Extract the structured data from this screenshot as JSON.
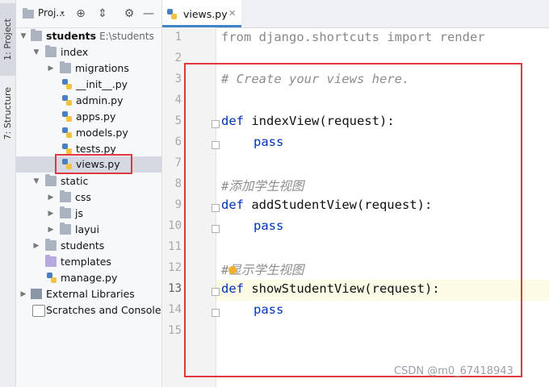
{
  "sidebar_tabs": {
    "project": "1: Project",
    "structure": "7: Structure"
  },
  "project_toolbar": {
    "title": "Proj...",
    "icons": [
      "globe-icon",
      "collapse-icon",
      "gear-icon",
      "hide-icon"
    ]
  },
  "tree": {
    "root": {
      "name": "students",
      "path": "E:\\students"
    },
    "index": "index",
    "migrations": "migrations",
    "init": "__init__.py",
    "admin": "admin.py",
    "apps": "apps.py",
    "models": "models.py",
    "tests": "tests.py",
    "views": "views.py",
    "static": "static",
    "css": "css",
    "js": "js",
    "layui": "layui",
    "students_pkg": "students",
    "templates": "templates",
    "manage": "manage.py",
    "external": "External Libraries",
    "scratches": "Scratches and Consoles"
  },
  "editor": {
    "tab_label": "views.py",
    "line_numbers": [
      "1",
      "2",
      "3",
      "4",
      "5",
      "6",
      "7",
      "8",
      "9",
      "10",
      "11",
      "12",
      "13",
      "14",
      "15"
    ],
    "lines": {
      "l1_from": "from",
      "l1_module": " django.shortcuts ",
      "l1_import": "import",
      "l1_name": " render",
      "l3": "# Create your views here.",
      "l5_def": "def",
      "l5_rest": " indexView(request):",
      "l6": "pass",
      "l8_hash": "#",
      "l8_text": "添加学生视图",
      "l9_def": "def",
      "l9_rest": " addStudentView(request):",
      "l10": "pass",
      "l12_hash": "#",
      "l12_text": "显示学生视图",
      "l13_def": "def",
      "l13_rest": " showStudentView(request):",
      "l14": "pass"
    }
  },
  "watermark": "CSDN @m0_67418943",
  "colors": {
    "highlight_box": "#e0383e",
    "keyword": "#0033b3",
    "tab_underline": "#4083c9"
  }
}
